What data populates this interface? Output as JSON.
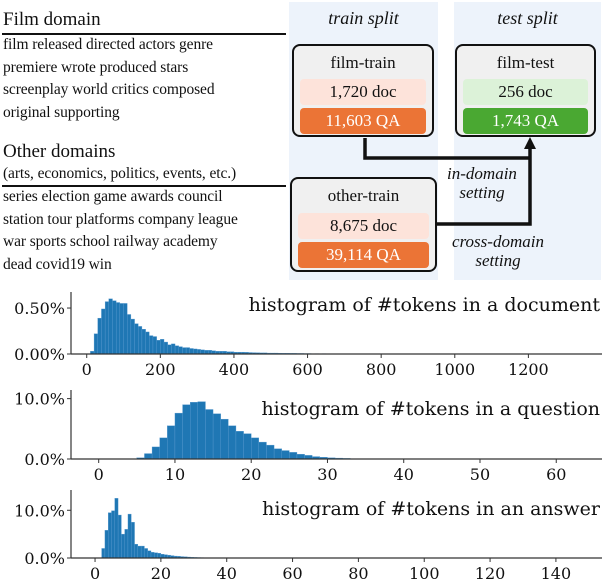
{
  "film_domain": {
    "title": "Film domain",
    "lines": [
      "film released directed actors genre",
      "premiere wrote produced stars",
      "screenplay world critics composed",
      "original supporting"
    ]
  },
  "other_domains": {
    "title": "Other domains",
    "subtitle": "(arts, economics, politics, events, etc.)",
    "lines": [
      "series election game awards council",
      "station tour platforms company league",
      "war sports school railway academy",
      "dead covid19 win"
    ]
  },
  "splits": {
    "train": {
      "title": "train split"
    },
    "test": {
      "title": "test split"
    }
  },
  "cards": {
    "film_train": {
      "name": "film-train",
      "doc": "1,720 doc",
      "qa": "11,603 QA"
    },
    "film_test": {
      "name": "film-test",
      "doc": "256 doc",
      "qa": "1,743 QA"
    },
    "other_train": {
      "name": "other-train",
      "doc": "8,675 doc",
      "qa": "39,114 QA"
    }
  },
  "settings": {
    "in_domain": [
      "in-domain",
      "setting"
    ],
    "cross_domain": [
      "cross-domain",
      "setting"
    ]
  },
  "colors": {
    "panel": "#edf3fb",
    "card": "#f0f0f0",
    "doc_orange": "#fde3da",
    "qa_orange": "#eb7436",
    "doc_green": "#dcf2d8",
    "qa_green": "#4aa832",
    "bar": "#1f77b4"
  },
  "chart_data": [
    {
      "type": "bar",
      "title": "histogram of #tokens in a document",
      "bin_width": 10,
      "x": [
        10,
        20,
        30,
        40,
        50,
        60,
        70,
        80,
        90,
        100,
        110,
        120,
        130,
        140,
        150,
        160,
        170,
        180,
        190,
        200,
        210,
        220,
        230,
        240,
        250,
        260,
        270,
        280,
        290,
        300,
        310,
        320,
        330,
        340,
        350,
        360,
        370,
        380,
        390,
        400,
        410,
        420,
        430,
        440,
        450,
        460,
        470,
        480,
        490,
        500,
        510,
        520,
        530,
        540,
        550,
        560,
        570,
        580,
        590,
        600,
        620,
        640,
        660,
        680,
        700
      ],
      "values": [
        0.03,
        0.22,
        0.39,
        0.49,
        0.57,
        0.6,
        0.58,
        0.56,
        0.55,
        0.55,
        0.43,
        0.38,
        0.33,
        0.3,
        0.27,
        0.24,
        0.2,
        0.19,
        0.15,
        0.16,
        0.13,
        0.1,
        0.11,
        0.09,
        0.08,
        0.07,
        0.07,
        0.06,
        0.055,
        0.05,
        0.045,
        0.04,
        0.04,
        0.035,
        0.03,
        0.03,
        0.03,
        0.025,
        0.025,
        0.02,
        0.02,
        0.02,
        0.018,
        0.016,
        0.015,
        0.014,
        0.012,
        0.012,
        0.01,
        0.01,
        0.01,
        0.009,
        0.008,
        0.008,
        0.007,
        0.007,
        0.006,
        0.006,
        0.005,
        0.005,
        0.004,
        0.004,
        0.003,
        0.003,
        0.002
      ],
      "xticks": [
        0,
        200,
        400,
        600,
        800,
        1000,
        1200
      ],
      "xtick_labels": [
        "0",
        "200",
        "400",
        "600",
        "800",
        "1000",
        "1200"
      ],
      "yticks": [
        0,
        0.5
      ],
      "ytick_labels": [
        "0.00%",
        "0.50%"
      ],
      "xlim": [
        -40,
        1400
      ],
      "ylim": [
        0,
        0.62
      ],
      "xlabel": "",
      "ylabel": ""
    },
    {
      "type": "bar",
      "title": "histogram of #tokens in a question",
      "bin_width": 1,
      "x": [
        5,
        6,
        7,
        8,
        9,
        10,
        11,
        12,
        13,
        14,
        15,
        16,
        17,
        18,
        19,
        20,
        21,
        22,
        23,
        24,
        25,
        26,
        27,
        28,
        29,
        30,
        31,
        32,
        33
      ],
      "values": [
        0.2,
        0.9,
        2.0,
        3.5,
        5.5,
        7.6,
        9.0,
        9.4,
        9.5,
        8.2,
        7.5,
        6.6,
        5.5,
        4.6,
        4.2,
        3.5,
        2.8,
        2.3,
        1.7,
        1.4,
        1.1,
        0.8,
        0.6,
        0.4,
        0.3,
        0.2,
        0.15,
        0.1,
        0.05
      ],
      "xticks": [
        0,
        10,
        20,
        30,
        40,
        50,
        60
      ],
      "xtick_labels": [
        "0",
        "10",
        "20",
        "30",
        "40",
        "50",
        "60"
      ],
      "yticks": [
        0,
        10
      ],
      "ytick_labels": [
        "0.0%",
        "10.0%"
      ],
      "xlim": [
        -3.5,
        66
      ],
      "ylim": [
        0,
        10.6
      ],
      "xlabel": "",
      "ylabel": ""
    },
    {
      "type": "bar",
      "title": "histogram of #tokens in an answer",
      "bin_width": 1,
      "x": [
        2,
        3,
        4,
        5,
        6,
        7,
        8,
        9,
        10,
        11,
        12,
        13,
        14,
        15,
        16,
        17,
        18,
        19,
        20,
        21,
        22,
        23,
        24,
        25,
        26,
        27,
        28,
        29,
        30,
        31,
        32,
        33,
        34,
        35
      ],
      "values": [
        2.0,
        5.8,
        9.5,
        9.9,
        12.5,
        9.0,
        5.0,
        6.0,
        9.2,
        7.5,
        2.9,
        2.5,
        2.5,
        2.0,
        1.5,
        1.2,
        1.1,
        1.0,
        0.8,
        0.7,
        0.6,
        0.5,
        0.4,
        0.35,
        0.3,
        0.25,
        0.2,
        0.15,
        0.12,
        0.1,
        0.08,
        0.06,
        0.05,
        0.04
      ],
      "xticks": [
        0,
        20,
        40,
        60,
        80,
        100,
        120,
        140
      ],
      "xtick_labels": [
        "0",
        "20",
        "40",
        "60",
        "80",
        "100",
        "120",
        "140"
      ],
      "yticks": [
        0,
        10
      ],
      "ytick_labels": [
        "0.0%",
        "10.0%"
      ],
      "xlim": [
        -7,
        154
      ],
      "ylim": [
        0,
        13.2
      ],
      "xlabel": "",
      "ylabel": ""
    }
  ]
}
